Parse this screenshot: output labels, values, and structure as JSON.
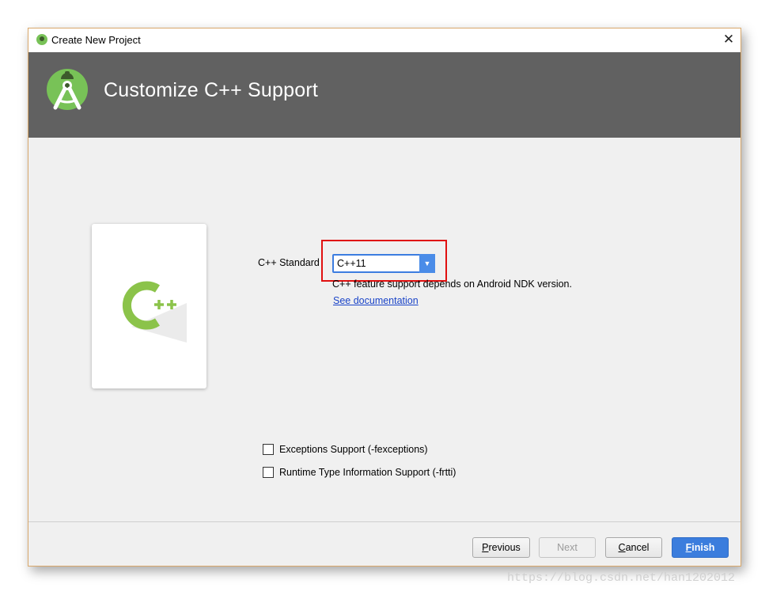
{
  "window": {
    "title": "Create New Project",
    "close_symbol": "✕"
  },
  "header": {
    "title": "Customize C++ Support",
    "logo_icon": "android-studio-logo-icon"
  },
  "main": {
    "cpp_standard": {
      "label": "C++ Standard",
      "selected": "C++11",
      "arrow": "▼"
    },
    "hint": "C++ feature support depends on Android NDK version.",
    "doc_link": "See documentation",
    "checkboxes": [
      {
        "label": "Exceptions Support (-fexceptions)",
        "checked": false
      },
      {
        "label": "Runtime Type Information Support (-frtti)",
        "checked": false
      }
    ],
    "card_icon": "cpp-icon"
  },
  "buttons": {
    "previous_rest": "revious",
    "previous_first": "P",
    "next": "Next",
    "cancel_first": "C",
    "cancel_rest": "ancel",
    "finish_first": "F",
    "finish_rest": "inish"
  },
  "colors": {
    "accent": "#3b7ddd",
    "header_bg": "#616161",
    "android_green": "#78c257",
    "highlight": "#e01010"
  },
  "watermark": "https://blog.csdn.net/han1202012"
}
